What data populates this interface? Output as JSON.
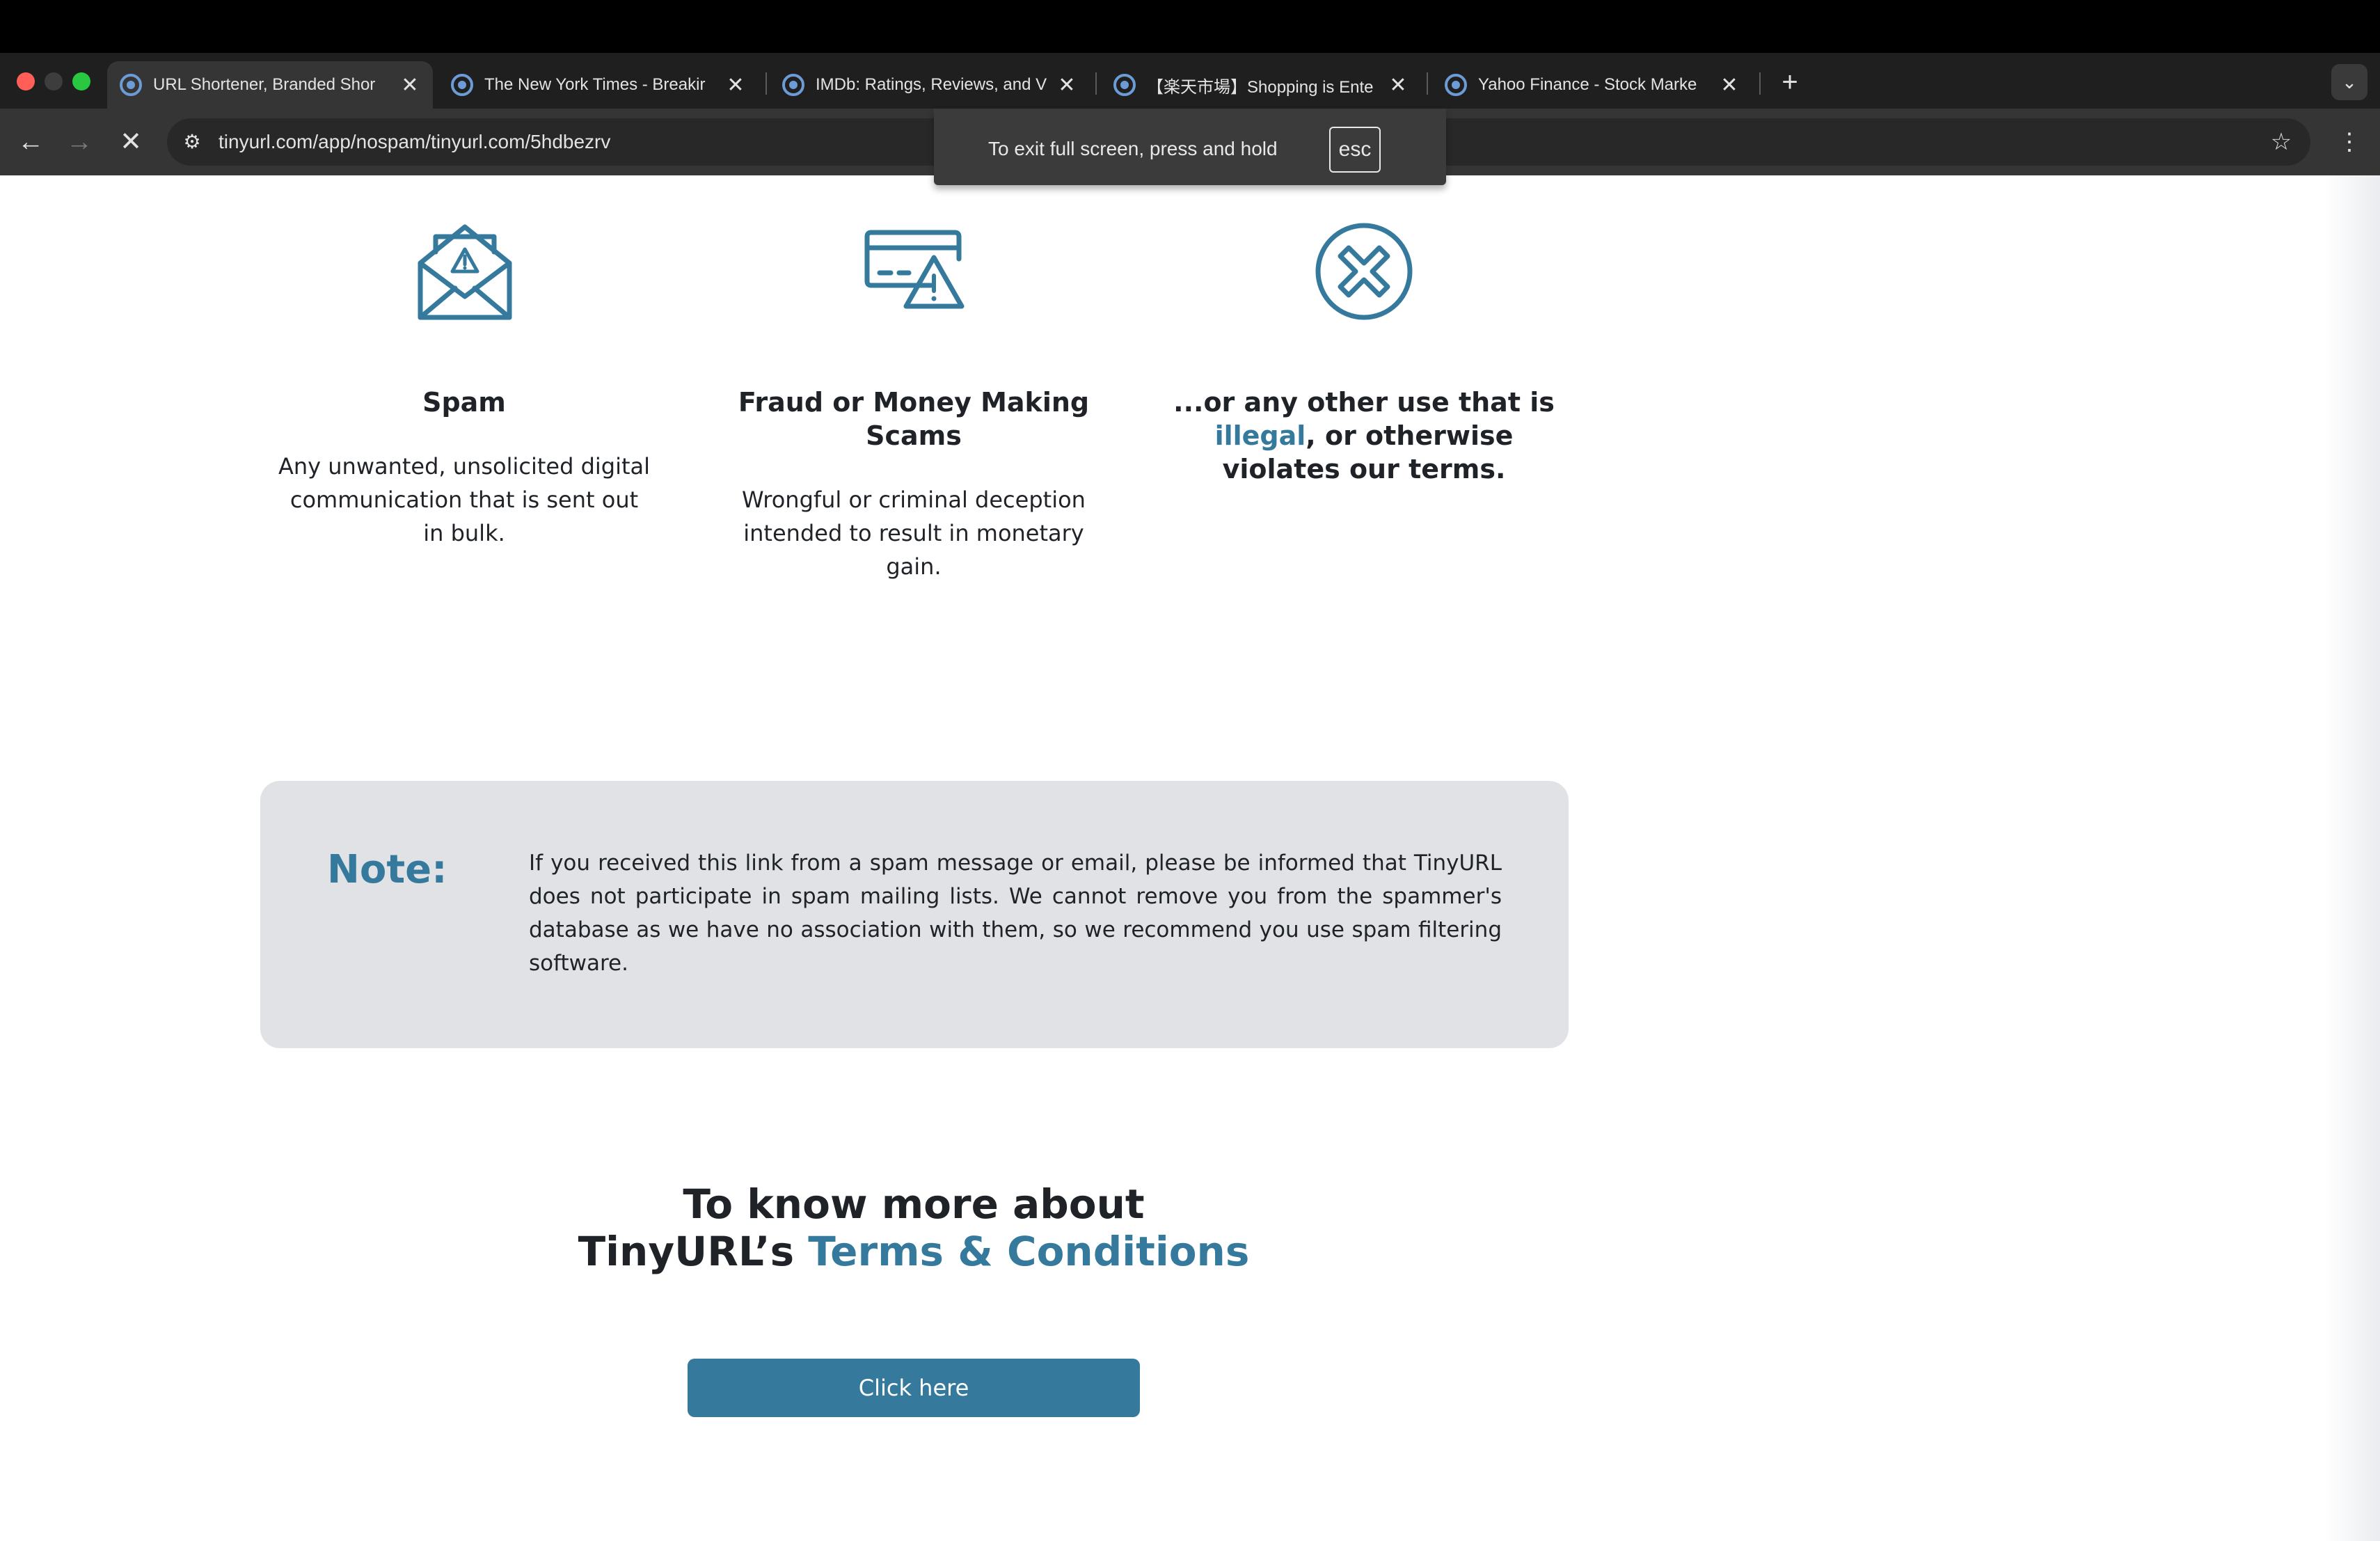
{
  "browser": {
    "tabs": [
      {
        "title": "URL Shortener, Branded Shor",
        "active": true
      },
      {
        "title": "The New York Times - Breakir",
        "active": false
      },
      {
        "title": "IMDb: Ratings, Reviews, and V",
        "active": false
      },
      {
        "title": "【楽天市場】Shopping is Ente",
        "active": false
      },
      {
        "title": "Yahoo Finance - Stock Marke",
        "active": false
      }
    ],
    "close_glyph": "✕",
    "new_tab_glyph": "+",
    "tab_search_glyph": "⌄",
    "url": "tinyurl.com/app/nospam/tinyurl.com/5hdbezrv",
    "fullscreen_toast": {
      "text": "To exit full screen, press and hold",
      "key": "esc"
    },
    "icons": {
      "back": "←",
      "forward": "→",
      "stop": "✕",
      "site_info": "⚙",
      "bookmark": "☆",
      "menu": "⋮"
    }
  },
  "page": {
    "columns": [
      {
        "icon": "spam-envelope-icon",
        "title": "Spam",
        "description": [
          "Any unwanted, unsolicited digital",
          "communication that is sent out",
          "in bulk."
        ]
      },
      {
        "icon": "fraud-card-icon",
        "title_lines": [
          "Fraud or Money Making",
          "Scams"
        ],
        "description": [
          "Wrongful or criminal deception",
          "intended to result in monetary",
          "gain."
        ]
      },
      {
        "icon": "prohibited-icon",
        "title_part1": "...or any other use that is",
        "title_accent": "illegal",
        "title_part2": ", or otherwise",
        "title_part3": "violates our terms."
      }
    ],
    "note": {
      "label": "Note:",
      "text": "If you received this link from a spam message or email, please be informed that TinyURL does not participate in spam mailing lists. We cannot remove you from the spammer's database as we have no association with them, so we recommend you use spam filtering software."
    },
    "cta": {
      "line1": "To know more about",
      "line2_prefix": "TinyURL’s ",
      "line2_accent": "Terms & Conditions",
      "button_label": "Click here"
    },
    "colors": {
      "accent": "#357a9d",
      "note_bg": "#e0e2e6"
    }
  }
}
